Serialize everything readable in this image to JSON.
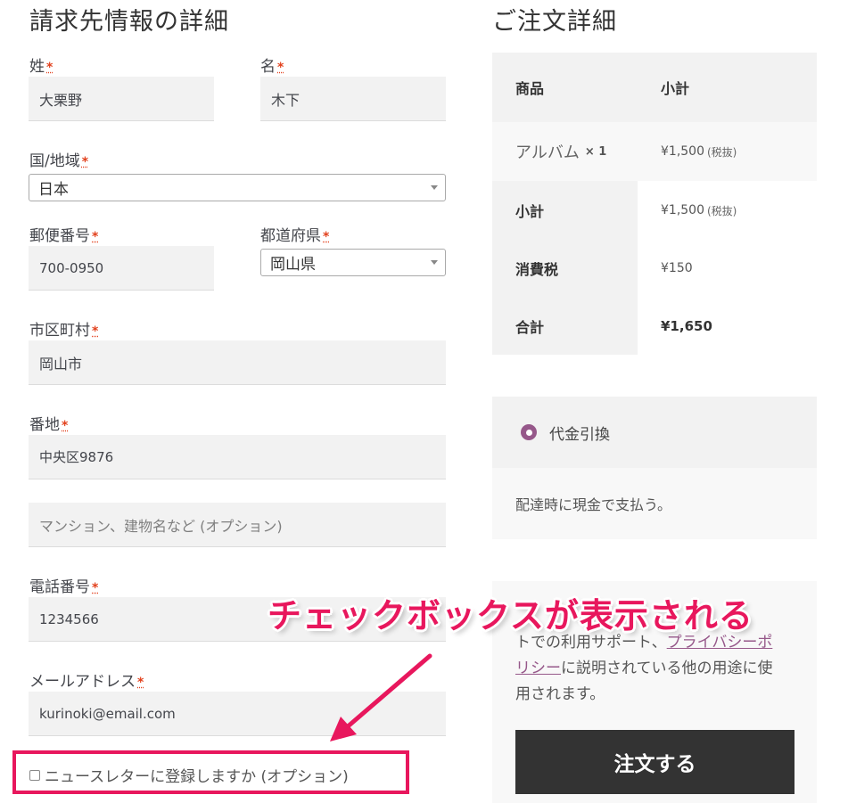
{
  "billing": {
    "heading": "請求先情報の詳細",
    "required_mark": "*",
    "last_name": {
      "label": "姓",
      "value": "大栗野"
    },
    "first_name": {
      "label": "名",
      "value": "木下"
    },
    "country": {
      "label": "国/地域",
      "value": "日本"
    },
    "postcode": {
      "label": "郵便番号",
      "value": "700-0950"
    },
    "state": {
      "label": "都道府県",
      "value": "岡山県"
    },
    "city": {
      "label": "市区町村",
      "value": "岡山市"
    },
    "address1": {
      "label": "番地",
      "value": "中央区9876"
    },
    "address2": {
      "placeholder": "マンション、建物名など (オプション)"
    },
    "phone": {
      "label": "電話番号",
      "value": "1234566"
    },
    "email": {
      "label": "メールアドレス",
      "value": "kurinoki@email.com"
    },
    "newsletter": {
      "label": "ニュースレターに登録しますか (オプション)",
      "checked": false
    }
  },
  "order": {
    "heading": "ご注文詳細",
    "col_product": "商品",
    "col_subtotal": "小計",
    "item": {
      "name": "アルバム",
      "qty": "× 1",
      "price": "¥1,500",
      "tax_note": "(税抜)"
    },
    "subtotal": {
      "label": "小計",
      "value": "¥1,500",
      "tax_note": "(税抜)"
    },
    "tax": {
      "label": "消費税",
      "value": "¥150"
    },
    "total": {
      "label": "合計",
      "value": "¥1,650"
    }
  },
  "payment": {
    "method_label": "代金引換",
    "description": "配達時に現金で支払う。",
    "privacy_line1": "トでの利用サポート、",
    "privacy_link1": "プライバシーポ",
    "privacy_link2": "リシー",
    "privacy_line2": "に説明されている他の用途に使",
    "privacy_line3": "用されます。",
    "place_order": "注文する"
  },
  "annotation": {
    "text": "チェックボックスが表示される",
    "color": "#e8175d"
  }
}
